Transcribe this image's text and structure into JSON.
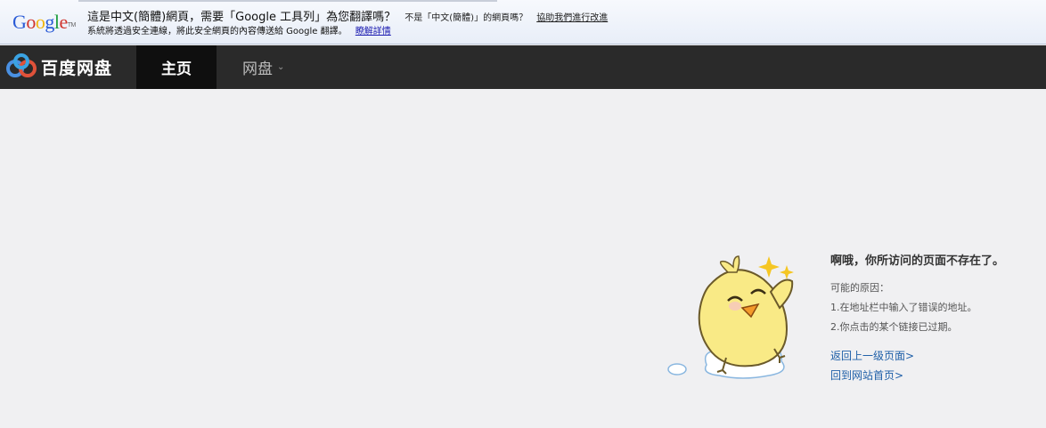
{
  "translate_bar": {
    "logo": "Google",
    "logo_tm": "TM",
    "message": "這是中文(簡體)網頁，需要「Google 工具列」為您翻譯嗎？",
    "not_language": "不是「中文(簡體)」的網頁嗎？",
    "help_link": "協助我們進行改進",
    "sub_message": "系統將透過安全連線，將此安全網頁的內容傳送給 Google 翻譯。",
    "learn_more": "瞭解詳情"
  },
  "nav": {
    "brand": "百度网盘",
    "tabs": [
      {
        "label": "主页",
        "active": true
      },
      {
        "label": "网盘",
        "active": false
      }
    ],
    "dropdown_icon": "chevron-down-icon"
  },
  "error": {
    "title": "啊哦，你所访问的页面不存在了。",
    "reasons_label": "可能的原因：",
    "reasons": [
      "1.在地址栏中输入了错误的地址。",
      "2.你点击的某个链接已过期。"
    ],
    "links": [
      "返回上一级页面>",
      "回到网站首页>"
    ]
  },
  "colors": {
    "nav_bg": "#2a2a2a",
    "active_tab_bg": "#0f0f0f",
    "link": "#1f5fa8",
    "page_bg": "#f0f0f2"
  }
}
